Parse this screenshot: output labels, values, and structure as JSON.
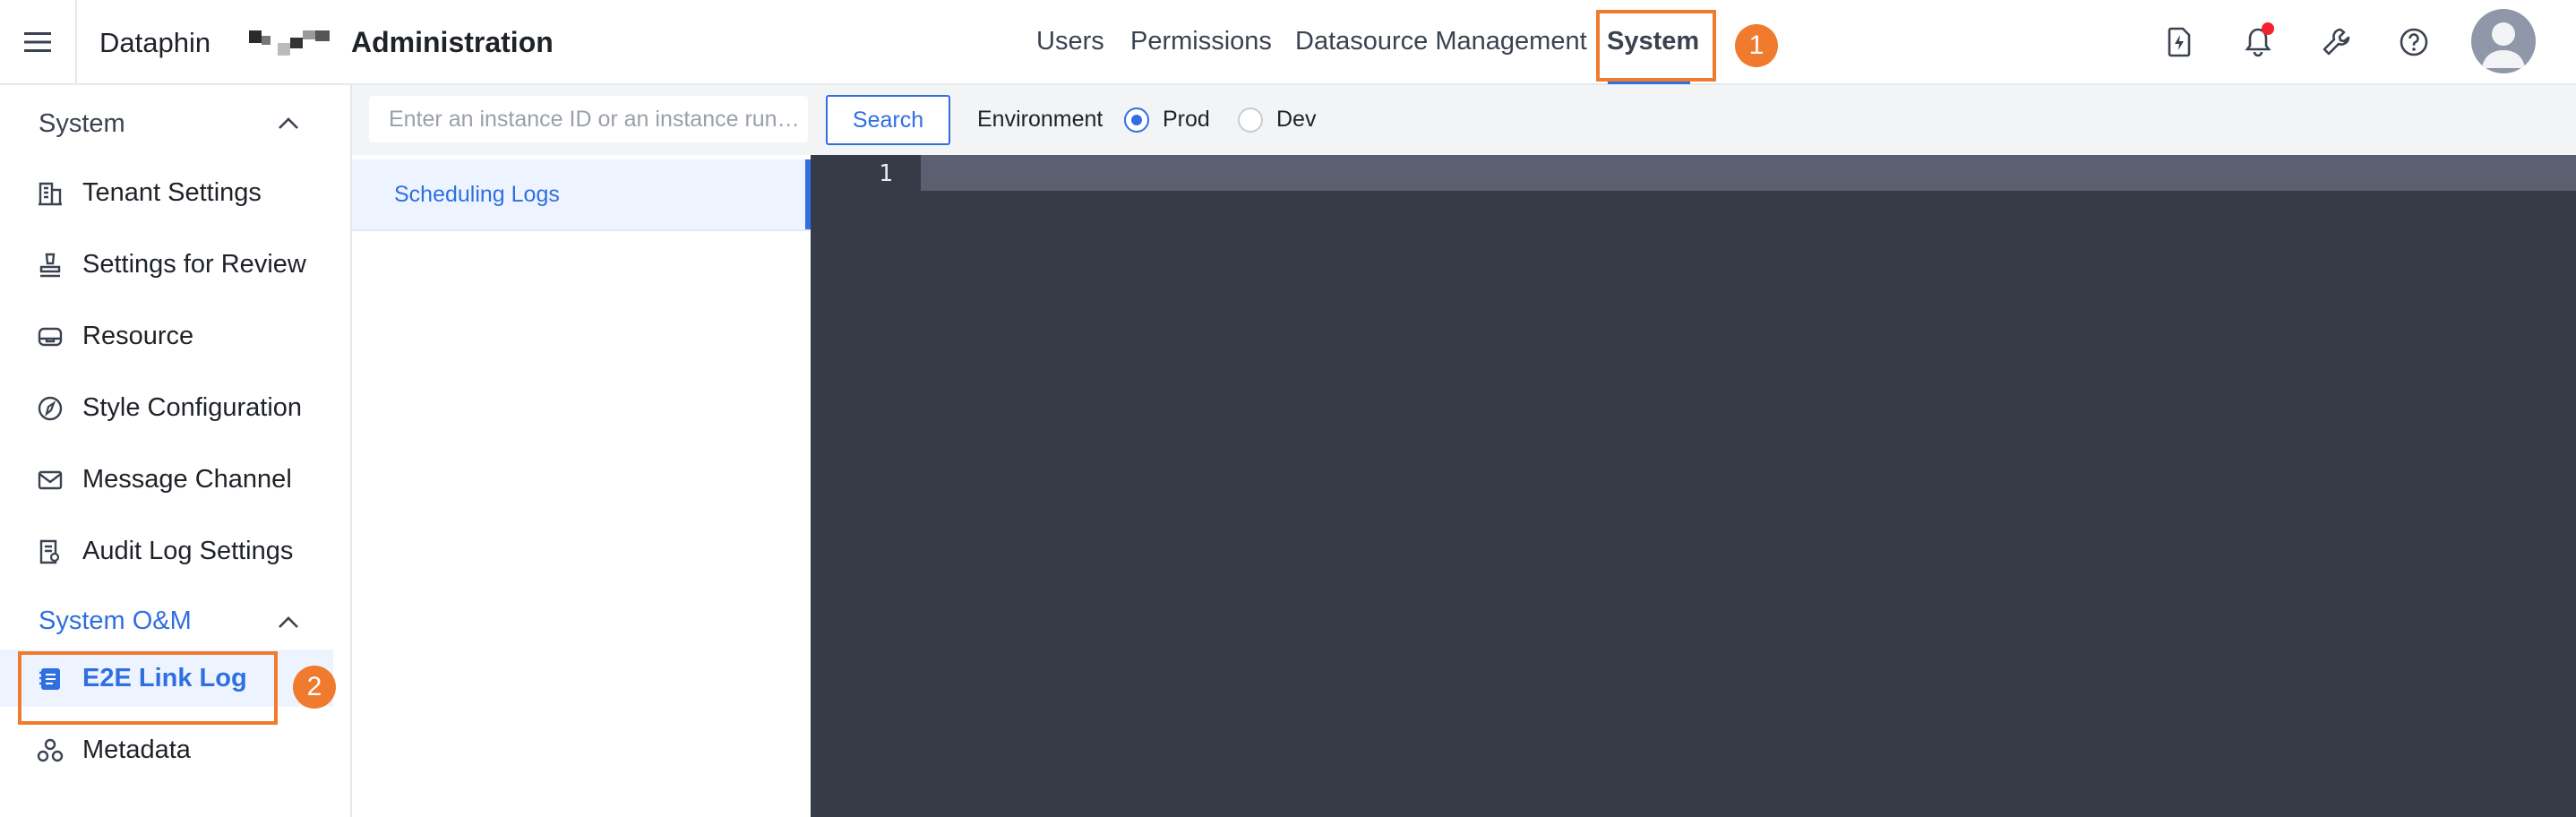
{
  "header": {
    "product": "Dataphin",
    "title": "Administration",
    "nav": [
      {
        "label": "Users"
      },
      {
        "label": "Permissions"
      },
      {
        "label": "Datasource Management"
      },
      {
        "label": "System"
      }
    ],
    "active_nav": "System",
    "callouts": [
      "1",
      "2"
    ],
    "icons": [
      "lightning-doc-icon",
      "bell-icon",
      "wrench-icon",
      "help-icon",
      "avatar"
    ]
  },
  "sidebar": {
    "section1": {
      "title": "System"
    },
    "items1": [
      {
        "label": "Tenant Settings",
        "icon": "building-icon"
      },
      {
        "label": "Settings for Review",
        "icon": "stamp-icon"
      },
      {
        "label": "Resource",
        "icon": "resource-icon"
      },
      {
        "label": "Style Configuration",
        "icon": "compass-icon"
      },
      {
        "label": "Message Channel",
        "icon": "mail-icon"
      },
      {
        "label": "Audit Log Settings",
        "icon": "audit-icon"
      }
    ],
    "section2": {
      "title": "System O&M"
    },
    "items2": [
      {
        "label": "E2E Link Log",
        "icon": "log-book-icon",
        "active": true
      },
      {
        "label": "Metadata",
        "icon": "metadata-icon"
      }
    ]
  },
  "toolbar": {
    "search_placeholder": "Enter an instance ID or an instance run…",
    "search_label": "Search",
    "environment_label": "Environment",
    "env_options": [
      {
        "label": "Prod",
        "selected": true
      },
      {
        "label": "Dev",
        "selected": false
      }
    ]
  },
  "list": {
    "items": [
      {
        "label": "Scheduling Logs",
        "selected": true
      }
    ]
  },
  "editor": {
    "line_numbers": [
      "1"
    ]
  },
  "colors": {
    "accent": "#2f6fe0",
    "highlight": "#f07b2e",
    "editor_bg": "#363b47"
  }
}
